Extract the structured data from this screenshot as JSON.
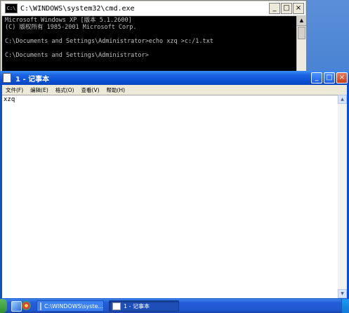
{
  "cmd_window": {
    "title": "C:\\WINDOWS\\system32\\cmd.exe",
    "icon": "cmd-icon",
    "buttons": {
      "minimize": "_",
      "maximize": "□",
      "close": "×"
    },
    "console_lines": [
      "Microsoft Windows XP [版本 5.1.2600]",
      "(C) 版权所有 1985-2001 Microsoft Corp.",
      "",
      "C:\\Documents and Settings\\Administrator>echo xzq >c:/1.txt",
      "",
      "C:\\Documents and Settings\\Administrator>"
    ],
    "colors": {
      "background": "#000000",
      "text": "#c0c0c0"
    }
  },
  "notepad_window": {
    "title": "1 - 记事本",
    "icon": "notepad-icon",
    "menu": [
      {
        "label": "文件(F)"
      },
      {
        "label": "编辑(E)"
      },
      {
        "label": "格式(O)"
      },
      {
        "label": "查看(V)"
      },
      {
        "label": "帮助(H)"
      }
    ],
    "content": "xzq",
    "colors": {
      "titlebar": "#0a50d4",
      "close_button": "#c8401a"
    }
  },
  "taskbar": {
    "quick_launch": [
      "show-desktop-icon",
      "browser-icon",
      "ie-icon"
    ],
    "tasks": [
      {
        "label": "C:\\WINDOWS\\syste...",
        "icon": "cmd-icon",
        "active": false
      },
      {
        "label": "1 - 记事本",
        "icon": "notepad-icon",
        "active": true
      }
    ],
    "colors": {
      "bar": "#245edb",
      "start": "#2f8f2f",
      "tray": "#1177d8"
    }
  }
}
